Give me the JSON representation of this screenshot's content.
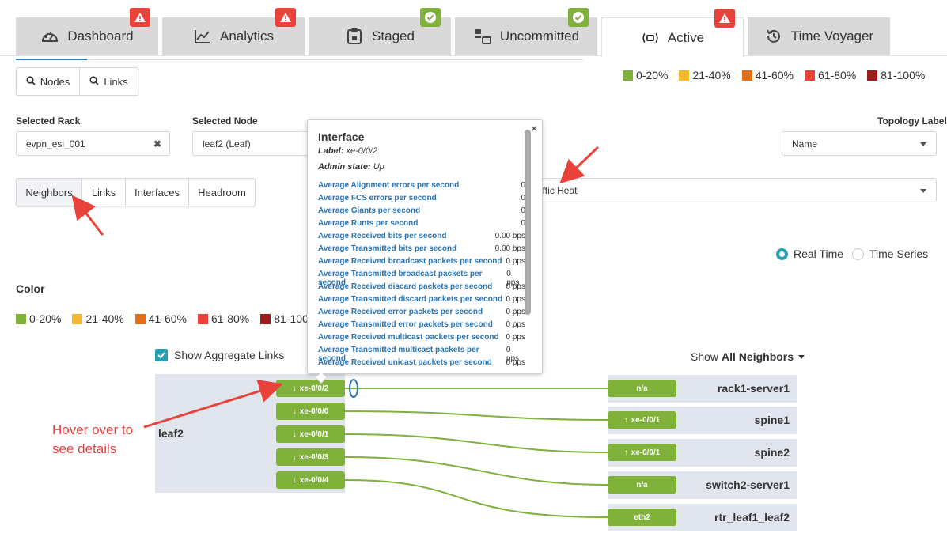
{
  "tabs": [
    {
      "label": "Dashboard",
      "status": "warning"
    },
    {
      "label": "Analytics",
      "status": "warning"
    },
    {
      "label": "Staged",
      "status": "ok"
    },
    {
      "label": "Uncommitted",
      "status": "ok"
    },
    {
      "label": "Active",
      "status": "warning",
      "active": true
    },
    {
      "label": "Time Voyager",
      "status": null
    }
  ],
  "view_toggle": {
    "nodes": "Nodes",
    "links": "Links"
  },
  "legend": [
    {
      "label": "0-20%",
      "color": "#7fb13b"
    },
    {
      "label": "21-40%",
      "color": "#f7b82b"
    },
    {
      "label": "41-60%",
      "color": "#e37019"
    },
    {
      "label": "61-80%",
      "color": "#e8423b"
    },
    {
      "label": "81-100%",
      "color": "#9e1b1b"
    }
  ],
  "legend_left_last": "81-100",
  "filters": {
    "selected_rack_label": "Selected Rack",
    "selected_rack_value": "evpn_esi_001",
    "selected_node_label": "Selected Node",
    "selected_node_value": "leaf2 (Leaf)",
    "topology_label_label": "Topology Label",
    "topology_label_value": "Name",
    "overlay_value": "affic Heat"
  },
  "subtabs": [
    "Neighbors",
    "Links",
    "Interfaces",
    "Headroom"
  ],
  "mode": {
    "real_time": "Real Time",
    "time_series": "Time Series",
    "selected": "real_time"
  },
  "color_heading": "Color",
  "show_aggregate_label": "Show Aggregate Links",
  "show_neighbors": {
    "prefix": "Show",
    "value": "All Neighbors"
  },
  "topology": {
    "node": "leaf2",
    "ports": [
      "xe-0/0/2",
      "xe-0/0/0",
      "xe-0/0/1",
      "xe-0/0/3",
      "xe-0/0/4"
    ],
    "neighbors": [
      {
        "name": "rack1-server1",
        "port": "n/a",
        "arrow": false
      },
      {
        "name": "spine1",
        "port": "xe-0/0/1",
        "arrow": true
      },
      {
        "name": "spine2",
        "port": "xe-0/0/1",
        "arrow": true
      },
      {
        "name": "switch2-server1",
        "port": "n/a",
        "arrow": false
      },
      {
        "name": "rtr_leaf1_leaf2",
        "port": "eth2",
        "arrow": false
      }
    ]
  },
  "tooltip": {
    "title": "Interface",
    "label_key": "Label:",
    "label_value": "xe-0/0/2",
    "admin_key": "Admin state:",
    "admin_value": "Up",
    "close": "×",
    "rows": [
      {
        "k": "Average Alignment errors per second",
        "v": "0"
      },
      {
        "k": "Average FCS errors per second",
        "v": "0"
      },
      {
        "k": "Average Giants per second",
        "v": "0"
      },
      {
        "k": "Average Runts per second",
        "v": "0"
      },
      {
        "k": "Average Received bits per second",
        "v": "0.00 bps"
      },
      {
        "k": "Average Transmitted bits per second",
        "v": "0.00 bps"
      },
      {
        "k": "Average Received broadcast packets per second",
        "v": "0 pps"
      },
      {
        "k": "Average Transmitted broadcast packets per second",
        "v": "0 pps"
      },
      {
        "k": "Average Received discard packets per second",
        "v": "0 pps"
      },
      {
        "k": "Average Transmitted discard packets per second",
        "v": "0 pps"
      },
      {
        "k": "Average Received error packets per second",
        "v": "0 pps"
      },
      {
        "k": "Average Transmitted error packets per second",
        "v": "0 pps"
      },
      {
        "k": "Average Received multicast packets per second",
        "v": "0 pps"
      },
      {
        "k": "Average Transmitted multicast packets per second",
        "v": "0 pps"
      },
      {
        "k": "Average Received unicast packets per second",
        "v": "0 pps"
      }
    ]
  },
  "annotation": {
    "line1": "Hover over to",
    "line2": "see details"
  }
}
